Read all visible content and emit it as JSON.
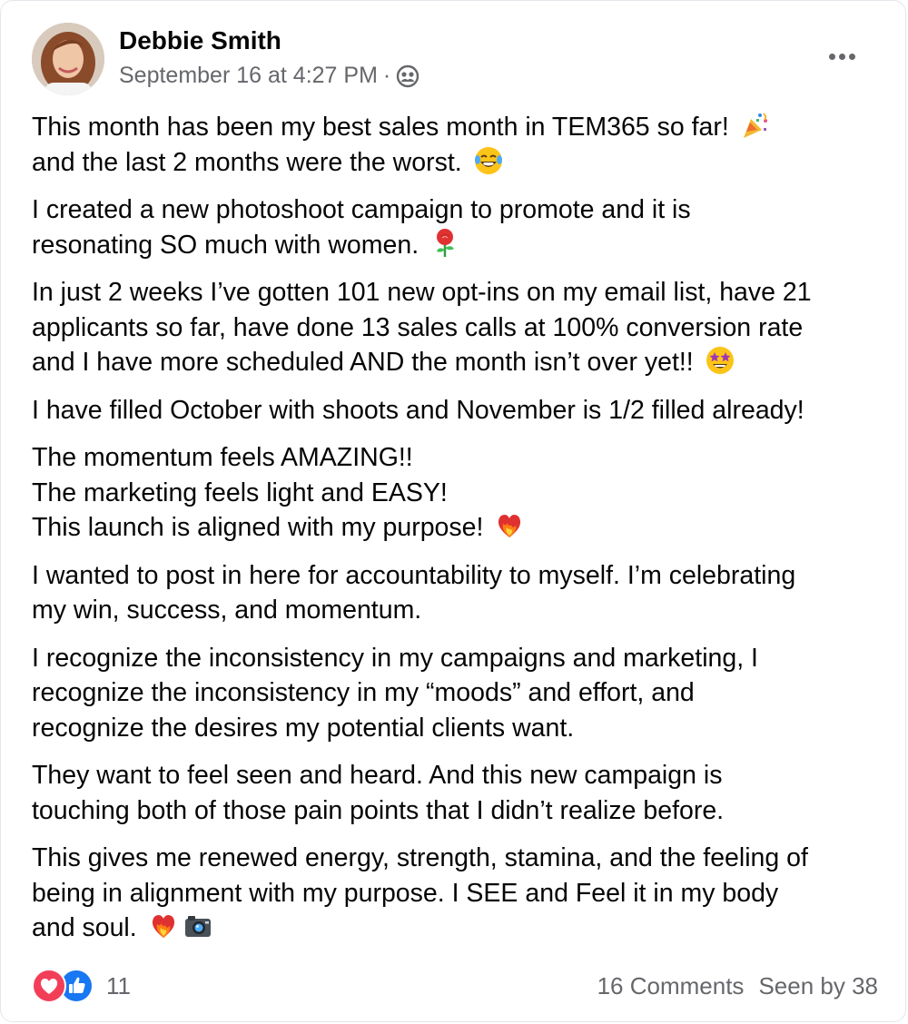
{
  "post": {
    "author": "Debbie Smith",
    "timestamp": "September 16 at 4:27 PM",
    "separator": "·",
    "audience_icon": "group-icon"
  },
  "paragraphs": [
    {
      "lines": [
        "This month has been my best sales month in TEM365 so far! ",
        "and the last 2 months were the worst. "
      ],
      "emojis": [
        "party-popper-emoji",
        "laughing-tears-emoji"
      ]
    },
    {
      "lines": [
        "I created a new photoshoot campaign to promote and it is",
        "resonating SO much with women. "
      ],
      "emojis": [
        "rose-emoji"
      ]
    },
    {
      "lines": [
        "In just 2 weeks I’ve gotten 101 new opt-ins on my email list, have 21",
        "applicants so far, have done 13 sales calls at 100% conversion rate",
        "and I have more scheduled AND the month isn’t over yet!! "
      ],
      "emojis": [
        "star-struck-emoji"
      ]
    },
    {
      "lines": [
        "I have filled October with shoots and November is 1/2 filled already!"
      ],
      "emojis": []
    },
    {
      "lines": [
        "The momentum feels AMAZING!!",
        "The marketing feels light and EASY!",
        "This launch is aligned with my purpose! "
      ],
      "emojis": [
        "heart-on-fire-emoji"
      ]
    },
    {
      "lines": [
        "I wanted to post in here for accountability to myself.  I’m celebrating",
        "my win, success, and momentum."
      ],
      "emojis": []
    },
    {
      "lines": [
        "I recognize the inconsistency in my campaigns and marketing, I",
        "recognize the inconsistency in my “moods” and effort, and",
        "recognize the desires my potential clients want."
      ],
      "emojis": []
    },
    {
      "lines": [
        "They want to feel seen and heard.  And this new campaign is",
        "touching both of those pain points that I didn’t realize before."
      ],
      "emojis": []
    },
    {
      "lines": [
        "This gives me renewed energy, strength, stamina, and the feeling of",
        "being in alignment with my purpose.  I SEE and Feel it in my body",
        "and soul. "
      ],
      "emojis": [
        "heart-on-fire-emoji",
        "camera-emoji"
      ]
    }
  ],
  "footer": {
    "reaction_count": "11",
    "comments": "16 Comments",
    "seen_by": "Seen by 38"
  },
  "colors": {
    "text": "#050505",
    "secondary": "#65676b",
    "love": "#f33e58",
    "like": "#1877f2"
  }
}
